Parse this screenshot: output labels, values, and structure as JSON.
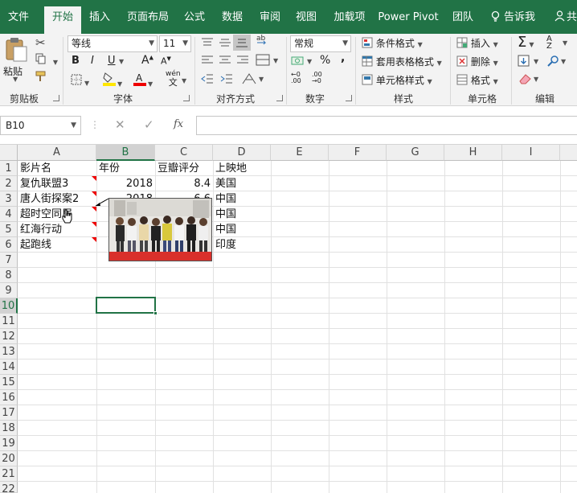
{
  "tabs": [
    "文件",
    "开始",
    "插入",
    "页面布局",
    "公式",
    "数据",
    "审阅",
    "视图",
    "加载项",
    "Power Pivot",
    "团队"
  ],
  "active_tab": "开始",
  "tell_me": "告诉我",
  "share": "共",
  "ribbon": {
    "clipboard": {
      "label": "剪贴板",
      "paste": "粘贴"
    },
    "font": {
      "label": "字体",
      "name": "等线",
      "size": "11",
      "bold": "B",
      "italic": "I",
      "underline": "U",
      "grow": "A",
      "shrink": "A",
      "phonetic": "wén",
      "phonetic_sub": "文"
    },
    "align": {
      "label": "对齐方式",
      "wrap": "ab"
    },
    "number": {
      "label": "数字",
      "format": "常规",
      "percent": "%",
      "comma": ","
    },
    "styles": {
      "label": "样式",
      "conditional": "条件格式",
      "table": "套用表格格式",
      "cell": "单元格样式"
    },
    "cells": {
      "label": "单元格",
      "insert": "插入",
      "delete": "删除",
      "format": "格式"
    },
    "editing": {
      "label": "编辑",
      "sigma": "Σ",
      "sort": "A",
      "sort_sub": "Z",
      "find": "⚲"
    }
  },
  "formula_bar": {
    "name_box": "B10",
    "fx": "fx",
    "cancel": "✕",
    "enter": "✓",
    "value": ""
  },
  "columns": [
    "A",
    "B",
    "C",
    "D",
    "E",
    "F",
    "G",
    "H",
    "I"
  ],
  "selected_column": "B",
  "rows": [
    "1",
    "2",
    "3",
    "4",
    "5",
    "6",
    "7",
    "8",
    "9",
    "10",
    "11",
    "12",
    "13",
    "14",
    "15",
    "16",
    "17",
    "18",
    "19",
    "20",
    "21",
    "22"
  ],
  "selected_row": "10",
  "table": {
    "headers": [
      "影片名",
      "年份",
      "豆瓣评分",
      "上映地"
    ],
    "records": [
      {
        "movie": "复仇联盟3",
        "year": "2018",
        "rating": "8.4",
        "region": "美国"
      },
      {
        "movie": "唐人街探案2",
        "year": "2018",
        "rating": "6.6",
        "region": "中国"
      },
      {
        "movie": "超时空同居",
        "year": "",
        "rating": "",
        "region": "中国"
      },
      {
        "movie": "红海行动",
        "year": "",
        "rating": "",
        "region": "中国"
      },
      {
        "movie": "起跑线",
        "year": "",
        "rating": "",
        "region": "印度"
      }
    ]
  },
  "colors": {
    "accent": "#217346",
    "comment_marker": "#e00000",
    "comment_floor": "#d9302b"
  }
}
